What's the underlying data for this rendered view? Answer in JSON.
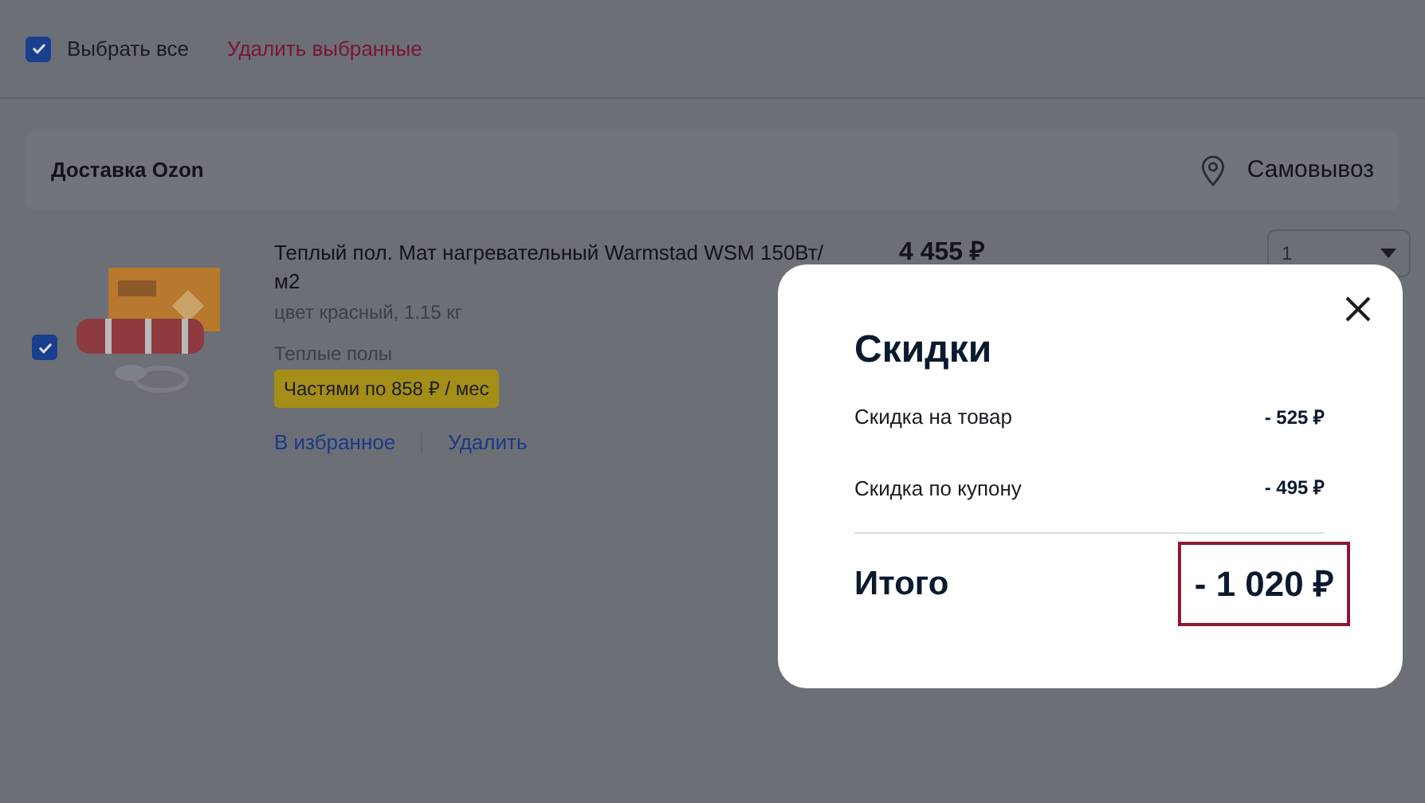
{
  "select_all": {
    "label": "Выбрать все",
    "checked": true
  },
  "delete_selected": "Удалить выбранные",
  "delivery": {
    "title": "Доставка Ozon",
    "pickup": "Самовывоз"
  },
  "items": [
    {
      "checked": true,
      "kind": "picture",
      "title": "Теплый пол. Мат нагревательный Warmstad WSM 150Вт/м2",
      "attributes": "цвет красный, 1.15 кг",
      "category": "Теплые полы",
      "installment": "Частями по 858 ₽ / мес",
      "price": "4 455 ₽",
      "quantity": "1",
      "actions": [
        "В избранное",
        "Удалить"
      ]
    }
  ],
  "modal": {
    "title": "Скидки",
    "rows": [
      {
        "label": "Скидка на товар",
        "value": "- 525 ₽"
      },
      {
        "label": "Скидка по купону",
        "value": "- 495 ₽"
      }
    ],
    "total": {
      "label": "Итого",
      "value": "- 1 020 ₽",
      "highlighted": true
    }
  }
}
